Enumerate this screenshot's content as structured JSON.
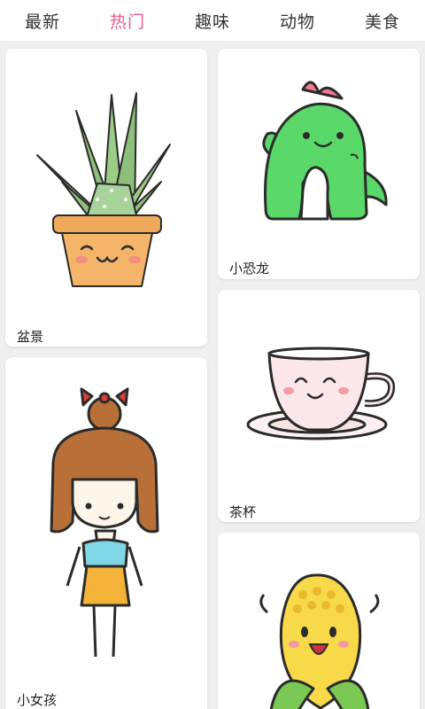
{
  "tabs": [
    {
      "label": "最新",
      "active": false
    },
    {
      "label": "热门",
      "active": true
    },
    {
      "label": "趣味",
      "active": false
    },
    {
      "label": "动物",
      "active": false
    },
    {
      "label": "美食",
      "active": false
    }
  ],
  "colors": {
    "accent": "#ea5b8c",
    "text": "#333333",
    "background": "#efefef",
    "card": "#ffffff"
  },
  "cards": [
    {
      "label": "盆景",
      "icon": "potted-aloe-drawing"
    },
    {
      "label": "小恐龙",
      "icon": "green-dinosaur-drawing"
    },
    {
      "label": "茶杯",
      "icon": "teacup-drawing"
    },
    {
      "label": "小女孩",
      "icon": "little-girl-drawing"
    },
    {
      "label": "",
      "icon": "corn-drawing"
    }
  ]
}
